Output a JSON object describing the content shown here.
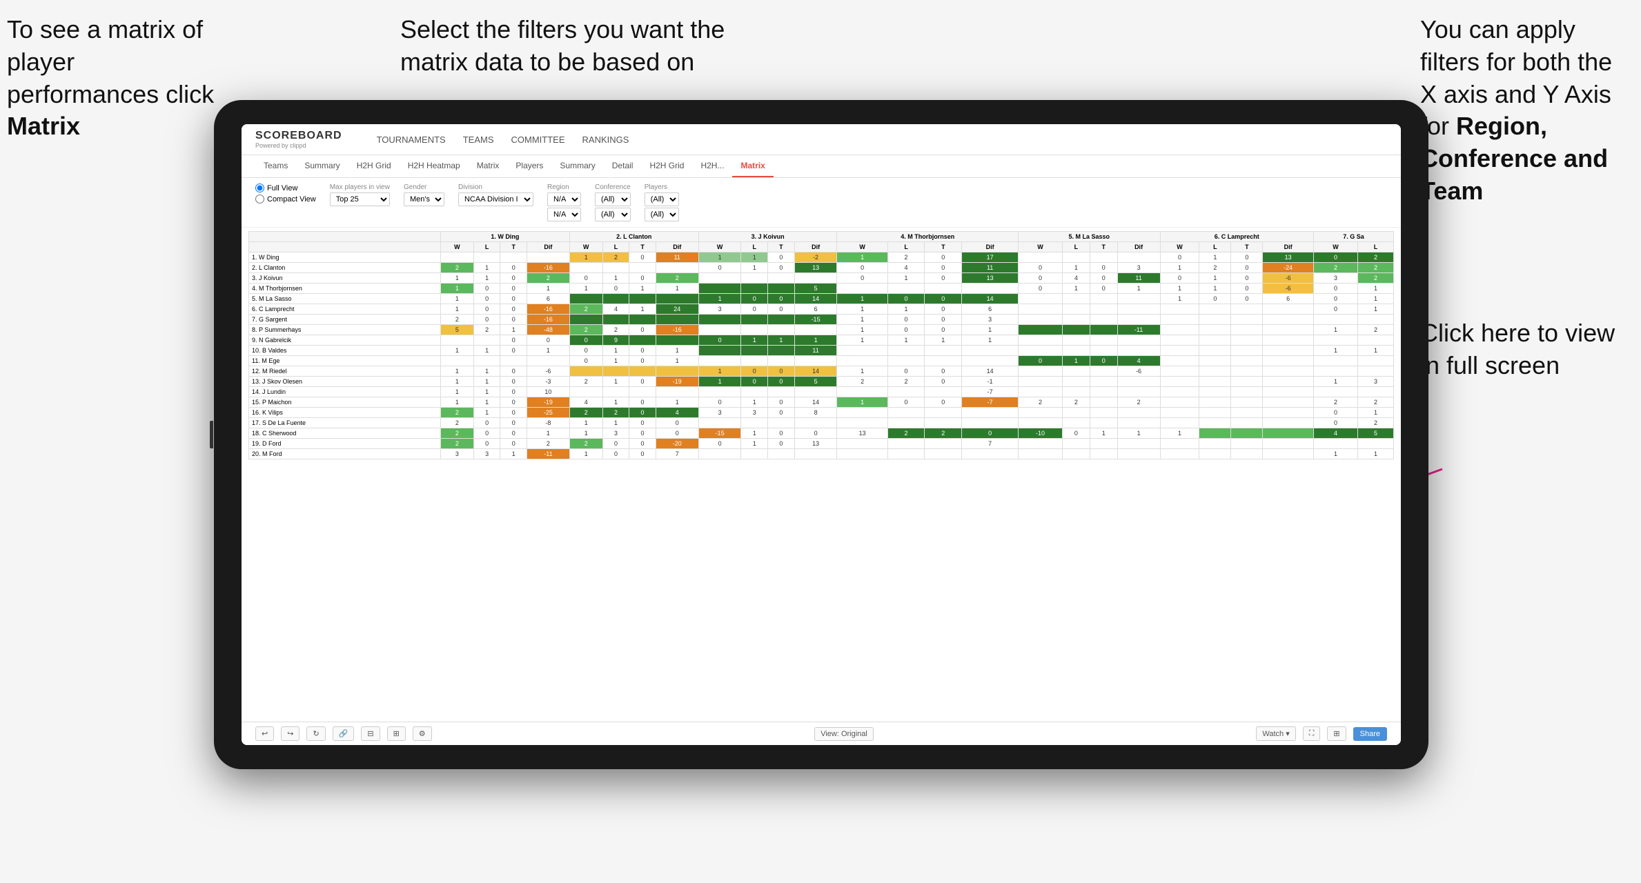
{
  "annotations": {
    "top_left": "To see a matrix of player performances click Matrix",
    "top_left_bold": "Matrix",
    "top_center": "Select the filters you want the matrix data to be based on",
    "top_right_line1": "You  can apply filters for both the X axis and Y Axis for ",
    "top_right_bold": "Region, Conference and Team",
    "bottom_right": "Click here to view in full screen"
  },
  "nav": {
    "logo": "SCOREBOARD",
    "logo_sub": "Powered by clippd",
    "items": [
      "TOURNAMENTS",
      "TEAMS",
      "COMMITTEE",
      "RANKINGS"
    ]
  },
  "sub_tabs": [
    "Teams",
    "Summary",
    "H2H Grid",
    "H2H Heatmap",
    "Matrix",
    "Players",
    "Summary",
    "Detail",
    "H2H Grid",
    "H2H...",
    "Matrix"
  ],
  "filters": {
    "view_options": [
      "Full View",
      "Compact View"
    ],
    "max_players": {
      "label": "Max players in view",
      "value": "Top 25"
    },
    "gender": {
      "label": "Gender",
      "value": "Men's"
    },
    "division": {
      "label": "Division",
      "value": "NCAA Division I"
    },
    "region": {
      "label": "Region",
      "value": "N/A",
      "value2": "N/A"
    },
    "conference": {
      "label": "Conference",
      "value": "(All)",
      "value2": "(All)"
    },
    "players": {
      "label": "Players",
      "value": "(All)",
      "value2": "(All)"
    }
  },
  "col_headers": [
    "1. W Ding",
    "2. L Clanton",
    "3. J Koivun",
    "4. M Thorbjornsen",
    "5. M La Sasso",
    "6. C Lamprecht",
    "7. G Sa"
  ],
  "col_sub": [
    "W",
    "L",
    "T",
    "Dif"
  ],
  "rows": [
    {
      "name": "1. W Ding",
      "data": "highlighted"
    },
    {
      "name": "2. L Clanton",
      "data": "normal"
    },
    {
      "name": "3. J Koivun",
      "data": "normal"
    },
    {
      "name": "4. M Thorbjornsen",
      "data": "normal"
    },
    {
      "name": "5. M La Sasso",
      "data": "normal"
    },
    {
      "name": "6. C Lamprecht",
      "data": "normal"
    },
    {
      "name": "7. G Sargent",
      "data": "normal"
    },
    {
      "name": "8. P Summerhays",
      "data": "normal"
    },
    {
      "name": "9. N Gabrelcik",
      "data": "normal"
    },
    {
      "name": "10. B Valdes",
      "data": "normal"
    },
    {
      "name": "11. M Ege",
      "data": "normal"
    },
    {
      "name": "12. M Riedel",
      "data": "normal"
    },
    {
      "name": "13. J Skov Olesen",
      "data": "normal"
    },
    {
      "name": "14. J Lundin",
      "data": "normal"
    },
    {
      "name": "15. P Maichon",
      "data": "normal"
    },
    {
      "name": "16. K Vilips",
      "data": "normal"
    },
    {
      "name": "17. S De La Fuente",
      "data": "normal"
    },
    {
      "name": "18. C Sherwood",
      "data": "normal"
    },
    {
      "name": "19. D Ford",
      "data": "normal"
    },
    {
      "name": "20. M Ford",
      "data": "normal"
    }
  ],
  "toolbar": {
    "view_label": "View: Original",
    "watch_label": "Watch ▾",
    "share_label": "Share"
  }
}
